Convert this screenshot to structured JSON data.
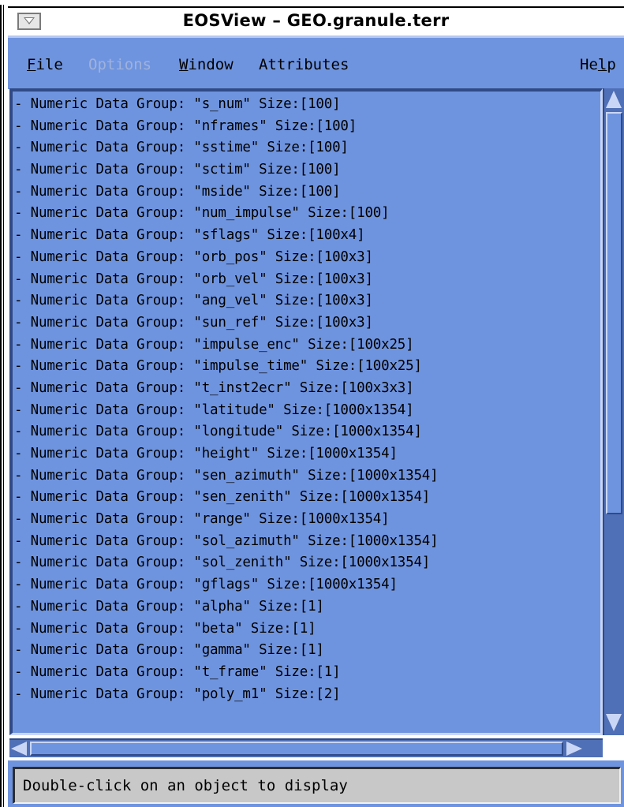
{
  "window": {
    "title": "EOSView – GEO.granule.terr"
  },
  "menubar": {
    "file": {
      "mnemonic": "F",
      "rest": "ile"
    },
    "options": {
      "label": "Options"
    },
    "window": {
      "mnemonic": "W",
      "rest": "indow"
    },
    "attributes": {
      "label": "Attributes"
    },
    "help": {
      "pre": "He",
      "mnemonic": "l",
      "rest": "p"
    }
  },
  "list": {
    "items": [
      "- Numeric Data Group: \"s_num\" Size:[100]",
      "- Numeric Data Group: \"nframes\" Size:[100]",
      "- Numeric Data Group: \"sstime\" Size:[100]",
      "- Numeric Data Group: \"sctim\" Size:[100]",
      "- Numeric Data Group: \"mside\" Size:[100]",
      "- Numeric Data Group: \"num_impulse\" Size:[100]",
      "- Numeric Data Group: \"sflags\" Size:[100x4]",
      "- Numeric Data Group: \"orb_pos\" Size:[100x3]",
      "- Numeric Data Group: \"orb_vel\" Size:[100x3]",
      "- Numeric Data Group: \"ang_vel\" Size:[100x3]",
      "- Numeric Data Group: \"sun_ref\" Size:[100x3]",
      "- Numeric Data Group: \"impulse_enc\" Size:[100x25]",
      "- Numeric Data Group: \"impulse_time\" Size:[100x25]",
      "- Numeric Data Group: \"t_inst2ecr\" Size:[100x3x3]",
      "- Numeric Data Group: \"latitude\" Size:[1000x1354]",
      "- Numeric Data Group: \"longitude\" Size:[1000x1354]",
      "- Numeric Data Group: \"height\" Size:[1000x1354]",
      "- Numeric Data Group: \"sen_azimuth\" Size:[1000x1354]",
      "- Numeric Data Group: \"sen_zenith\" Size:[1000x1354]",
      "- Numeric Data Group: \"range\" Size:[1000x1354]",
      "- Numeric Data Group: \"sol_azimuth\" Size:[1000x1354]",
      "- Numeric Data Group: \"sol_zenith\" Size:[1000x1354]",
      "- Numeric Data Group: \"gflags\" Size:[1000x1354]",
      "- Numeric Data Group: \"alpha\" Size:[1]",
      "- Numeric Data Group: \"beta\" Size:[1]",
      "- Numeric Data Group: \"gamma\" Size:[1]",
      "- Numeric Data Group: \"t_frame\" Size:[1]",
      "- Numeric Data Group: \"poly_m1\" Size:[2]"
    ]
  },
  "status": {
    "text": "Double-click on an object to display"
  },
  "icons": {
    "window_menu": "window-menu-icon",
    "scroll_up": "scroll-up-arrow-icon",
    "scroll_down": "scroll-down-arrow-icon",
    "scroll_left": "scroll-left-arrow-icon",
    "scroll_right": "scroll-right-arrow-icon"
  },
  "colors": {
    "background": "#6f94df",
    "scrollbar_trough": "#4f6fb6",
    "status_background": "#c8c8c8",
    "disabled_text": "#9fb2dc"
  }
}
